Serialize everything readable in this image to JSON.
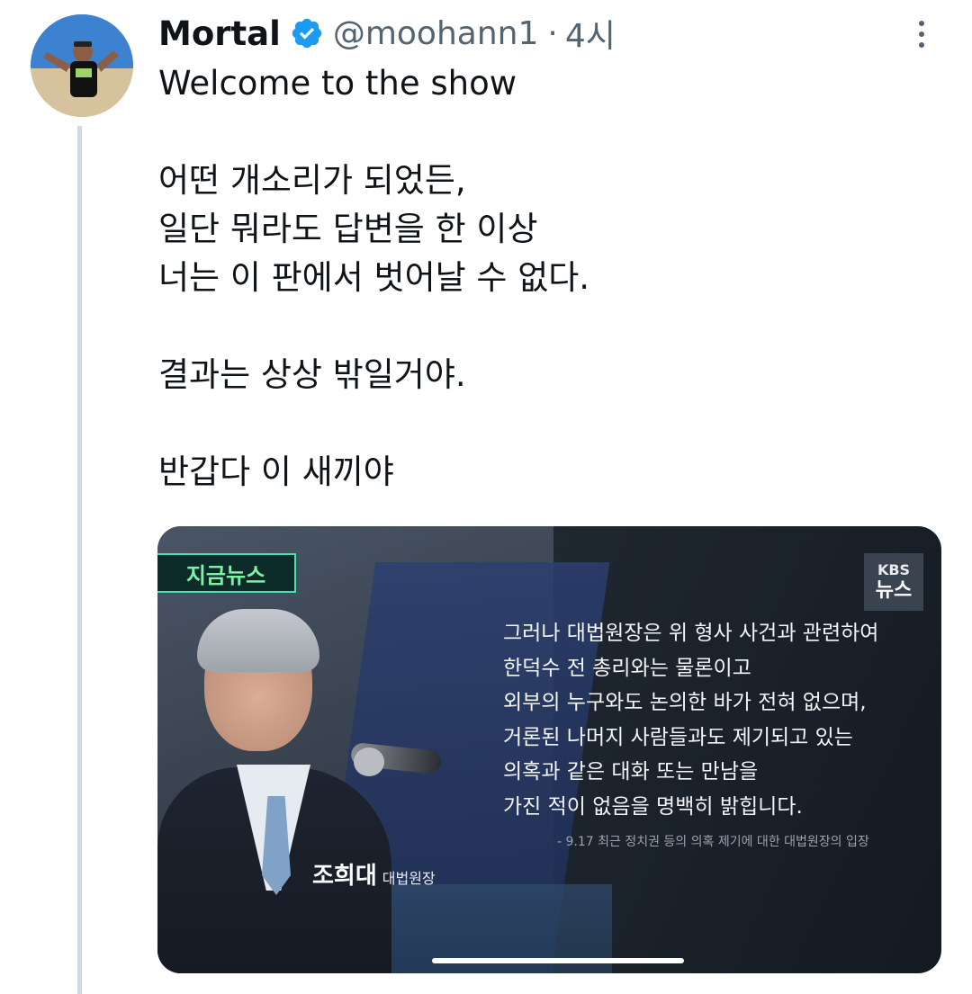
{
  "tweet": {
    "display_name": "Mortal",
    "handle": "@moohann1",
    "separator": "·",
    "time": "4시",
    "text_lines": [
      "Welcome to the show",
      "",
      "어떤 개소리가 되었든,",
      "일단 뭐라도 답변을 한 이상",
      "너는 이 판에서 벗어날 수 없다.",
      "",
      "결과는 상상 밖일거야.",
      "",
      "반갑다 이 새끼야"
    ]
  },
  "media": {
    "tag": "지금뉴스",
    "kbs_logo_top": "KBS",
    "kbs_logo_bottom": "뉴스",
    "quote_lines": [
      "그러나 대법원장은 위 형사 사건과 관련하여",
      "한덕수 전 총리와는 물론이고",
      "외부의 누구와도 논의한 바가 전혀 없으며,",
      "거론된 나머지 사람들과도 제기되고 있는",
      "의혹과 같은 대화 또는 만남을",
      "가진 적이 없음을 명백히 밝힙니다."
    ],
    "source": "- 9.17 최근 정치권 등의 의혹 제기에 대한 대법원장의 입장",
    "caption_name": "조희대",
    "caption_role": "대법원장"
  },
  "colors": {
    "verified_blue": "#1d9bf0",
    "handle_gray": "#536471",
    "thread_line": "#cfd9de"
  },
  "icons": {
    "verified": "verified-badge-icon",
    "more": "more-options-icon"
  }
}
